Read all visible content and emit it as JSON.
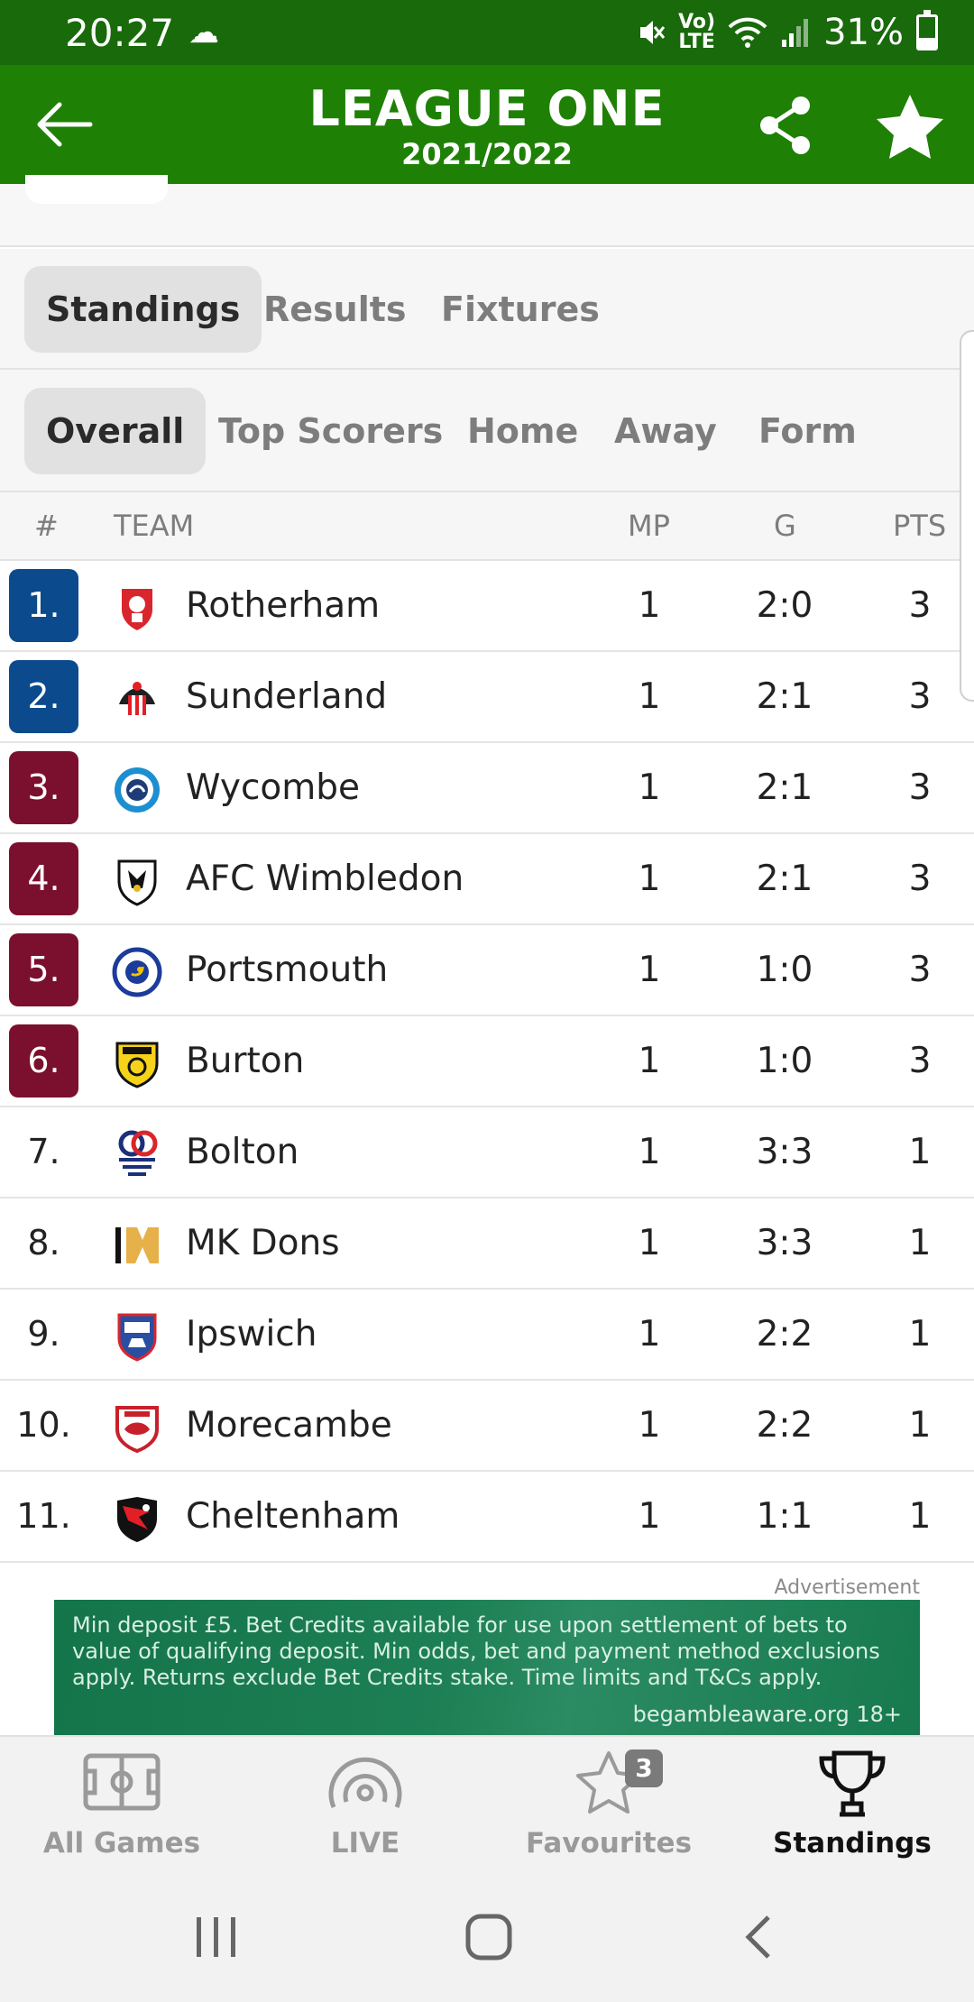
{
  "status_bar": {
    "time": "20:27",
    "battery": "31%",
    "signal_label_top": "Vo)",
    "signal_label_bottom": "LTE"
  },
  "header": {
    "title": "LEAGUE ONE",
    "season": "2021/2022"
  },
  "main_tabs": [
    {
      "label": "Standings",
      "active": true
    },
    {
      "label": "Results",
      "active": false
    },
    {
      "label": "Fixtures",
      "active": false
    }
  ],
  "sub_tabs": [
    {
      "label": "Overall",
      "active": true
    },
    {
      "label": "Top Scorers",
      "active": false
    },
    {
      "label": "Home",
      "active": false
    },
    {
      "label": "Away",
      "active": false
    },
    {
      "label": "Form",
      "active": false
    }
  ],
  "table": {
    "headers": {
      "rank": "#",
      "team": "TEAM",
      "mp": "MP",
      "goals": "G",
      "pts": "PTS"
    },
    "rows": [
      {
        "rank": "1.",
        "team": "Rotherham",
        "mp": "1",
        "goals": "2:0",
        "pts": "3",
        "zone": "promotion"
      },
      {
        "rank": "2.",
        "team": "Sunderland",
        "mp": "1",
        "goals": "2:1",
        "pts": "3",
        "zone": "promotion"
      },
      {
        "rank": "3.",
        "team": "Wycombe",
        "mp": "1",
        "goals": "2:1",
        "pts": "3",
        "zone": "playoff"
      },
      {
        "rank": "4.",
        "team": "AFC Wimbledon",
        "mp": "1",
        "goals": "2:1",
        "pts": "3",
        "zone": "playoff"
      },
      {
        "rank": "5.",
        "team": "Portsmouth",
        "mp": "1",
        "goals": "1:0",
        "pts": "3",
        "zone": "playoff"
      },
      {
        "rank": "6.",
        "team": "Burton",
        "mp": "1",
        "goals": "1:0",
        "pts": "3",
        "zone": "playoff"
      },
      {
        "rank": "7.",
        "team": "Bolton",
        "mp": "1",
        "goals": "3:3",
        "pts": "1",
        "zone": "none"
      },
      {
        "rank": "8.",
        "team": "MK Dons",
        "mp": "1",
        "goals": "3:3",
        "pts": "1",
        "zone": "none"
      },
      {
        "rank": "9.",
        "team": "Ipswich",
        "mp": "1",
        "goals": "2:2",
        "pts": "1",
        "zone": "none"
      },
      {
        "rank": "10.",
        "team": "Morecambe",
        "mp": "1",
        "goals": "2:2",
        "pts": "1",
        "zone": "none"
      },
      {
        "rank": "11.",
        "team": "Cheltenham",
        "mp": "1",
        "goals": "1:1",
        "pts": "1",
        "zone": "none"
      }
    ]
  },
  "ad": {
    "label": "Advertisement",
    "text": "Min deposit £5. Bet Credits available for use upon settlement of bets to value of qualifying deposit. Min odds, bet and payment method exclusions apply. Returns exclude Bet Credits stake. Time limits and T&Cs apply.",
    "footer": "begambleaware.org  18+"
  },
  "bottom_nav": [
    {
      "label": "All Games",
      "icon": "pitch-icon",
      "active": false
    },
    {
      "label": "LIVE",
      "icon": "live-broadcast-icon",
      "active": false
    },
    {
      "label": "Favourites",
      "icon": "star-outline-icon",
      "active": false,
      "badge": "3"
    },
    {
      "label": "Standings",
      "icon": "trophy-icon",
      "active": true
    }
  ],
  "colors": {
    "status_bar": "#186a0a",
    "app_bar": "#1f8006",
    "promotion": "#0b4a8c",
    "playoff": "#7b0f2e"
  },
  "icons": {
    "back": "arrow-left-icon",
    "share": "share-icon",
    "favourite": "star-filled-icon",
    "system_recents": "recents-icon",
    "system_home": "home-icon",
    "system_back": "back-chevron-icon"
  }
}
